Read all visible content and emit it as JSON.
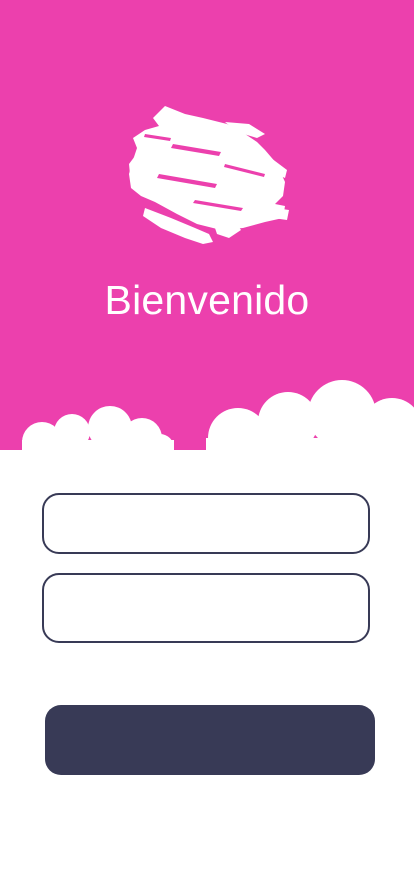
{
  "screen": {
    "title": "Bienvenido",
    "logo_icon": "brush-splash-icon"
  },
  "login_form": {
    "username_value": "",
    "username_placeholder": "",
    "password_value": "",
    "password_placeholder": "",
    "submit_label": ""
  },
  "colors": {
    "hero_background": "#ec40ad",
    "accent_dark": "#383a56",
    "clouds": "#ffffff"
  }
}
